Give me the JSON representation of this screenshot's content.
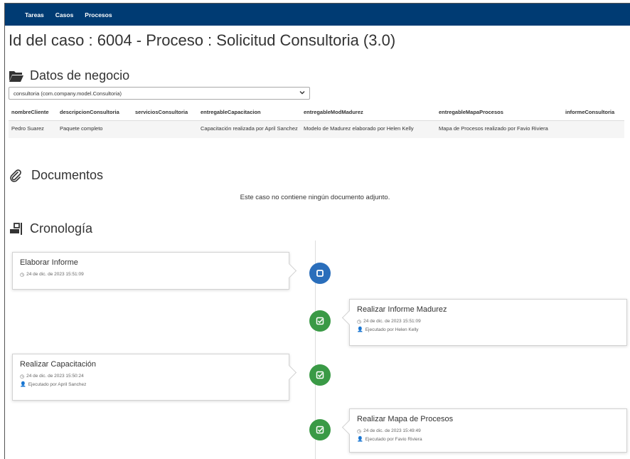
{
  "nav": {
    "items": [
      "Tareas",
      "Casos",
      "Procesos"
    ]
  },
  "page": {
    "title": "Id del caso : 6004 - Proceso : Solicitud Consultoria (3.0)"
  },
  "business": {
    "heading": "Datos de negocio",
    "select_value": "consultoria (com.company.model.Consultoria)",
    "columns": [
      "nombreCliente",
      "descripcionConsultoria",
      "serviciosConsultoria",
      "entregableCapacitacion",
      "entregableModMadurez",
      "entregableMapaProcesos",
      "informeConsultoria"
    ],
    "row": [
      "Pedro Suarez",
      "Paquete completo",
      "",
      "Capacitación realizada por April Sanchez",
      "Modelo de Madurez elaborado por Helen Kelly",
      "Mapa de Procesos realizado por Favio Riviera",
      ""
    ]
  },
  "documents": {
    "heading": "Documentos",
    "empty_text": "Este caso no contiene ningún documento adjunto."
  },
  "timeline": {
    "heading": "Cronología",
    "events": [
      {
        "title": "Elaborar Informe",
        "time": "24 de dic. de 2023 15:51:09",
        "executed_by": "",
        "status": "pending",
        "side": "left"
      },
      {
        "title": "Realizar Informe Madurez",
        "time": "24 de dic. de 2023 15:51:09",
        "executed_by": "Ejecutado por Helen Kelly",
        "status": "done",
        "side": "right"
      },
      {
        "title": "Realizar Capacitación",
        "time": "24 de dic. de 2023 15:50:24",
        "executed_by": "Ejecutado por April Sanchez",
        "status": "done",
        "side": "left"
      },
      {
        "title": "Realizar Mapa de Procesos",
        "time": "24 de dic. de 2023 15:49:49",
        "executed_by": "Ejecutado por Favio Riviera",
        "status": "done",
        "side": "right"
      }
    ]
  },
  "colors": {
    "navbar": "#003b73",
    "pending": "#2a6ebb",
    "done": "#3a9a46"
  },
  "icons": {
    "business": "folder-open-icon",
    "documents": "paperclip-icon",
    "timeline": "timeline-icon",
    "clock": "clock-icon",
    "user": "user-icon",
    "pending": "stop-icon",
    "done": "check-square-icon"
  }
}
